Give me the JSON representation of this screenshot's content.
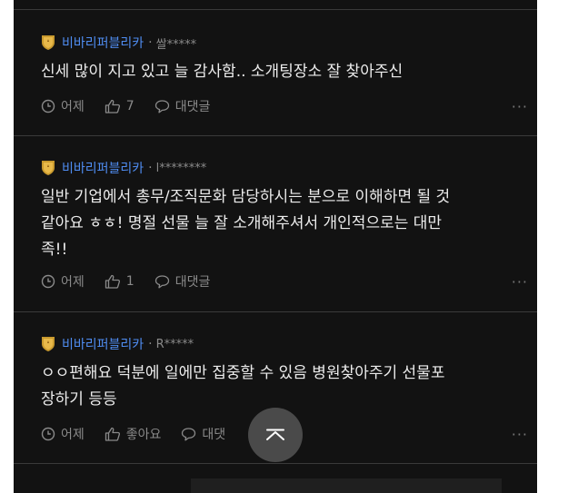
{
  "colors": {
    "background": "#121212",
    "company": "#4f8cf0",
    "text": "#ececec",
    "muted": "#8a8a8a",
    "divider": "#3a3a3a"
  },
  "comments": [
    {
      "company": "비바리퍼블리카",
      "separator": "·",
      "nickname": "쌀*****",
      "text": "신세 많이 지고 있고 늘 감사함.. 소개팅장소 잘 찾아주신",
      "time": "어제",
      "likes": "7",
      "reply_label": "대댓글",
      "more": "···",
      "icons": [
        "clock-icon",
        "thumbs-up-icon",
        "speech-bubble-icon",
        "more-icon"
      ]
    },
    {
      "company": "비바리퍼블리카",
      "separator": "·",
      "nickname": "l********",
      "text": "일반 기업에서 총무/조직문화 담당하시는 분으로 이해하면 될 것\n같아요 ㅎㅎ! 명절 선물 늘 잘 소개해주셔서 개인적으로는 대만\n족!!",
      "time": "어제",
      "likes": "1",
      "reply_label": "대댓글",
      "more": "···"
    },
    {
      "company": "비바리퍼블리카",
      "separator": "·",
      "nickname": "R*****",
      "text": "ㅇㅇ편해요 덕분에 일에만 집중할 수 있음 병원찾아주기 선물포\n장하기 등등",
      "time": "어제",
      "likes": "좋아요",
      "reply_label": "대댓",
      "more": "···"
    }
  ],
  "scroll_top": {
    "icon": "chevron-up-icon"
  }
}
